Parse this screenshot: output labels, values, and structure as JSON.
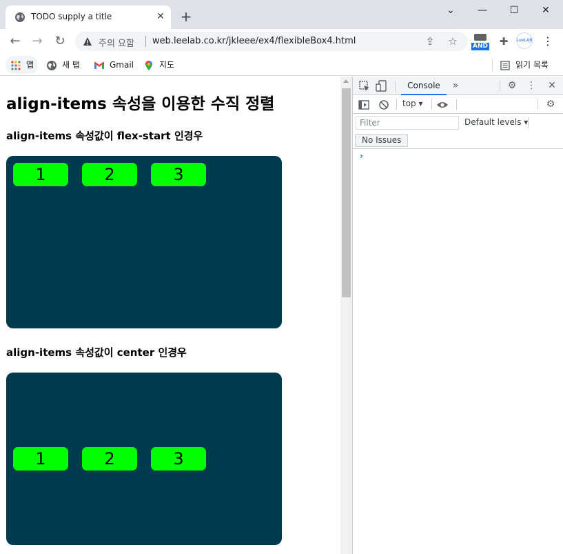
{
  "browser": {
    "tab_title": "TODO supply a title",
    "tab_close_glyph": "✕",
    "new_tab_glyph": "+",
    "window_controls": {
      "minimize": "—",
      "maximize": "☐",
      "close": "✕",
      "chevron": "⌄"
    },
    "nav": {
      "back": "←",
      "forward": "→",
      "reload": "↻"
    },
    "security_label": "주의 요함",
    "url": "web.leelab.co.kr/jkleee/ex4/flexibleBox4.html",
    "extensions": {
      "ext1_label": "AND",
      "ext2_label": "LeeLAB",
      "menu_glyph": "⋮"
    },
    "bookmarks": [
      {
        "label": "앱"
      },
      {
        "label": "새 탭"
      },
      {
        "label": "Gmail"
      },
      {
        "label": "지도"
      }
    ],
    "reading_list": "읽기 목록"
  },
  "page": {
    "heading": "align-items 속성을 이용한 수직 정렬",
    "sections": [
      {
        "subheading": "align-items 속성값이 flex-start 인경우",
        "items": [
          "1",
          "2",
          "3"
        ],
        "align": "flex-start"
      },
      {
        "subheading": "align-items 속성값이 center 인경우",
        "items": [
          "1",
          "2",
          "3"
        ],
        "align": "center"
      }
    ],
    "colors": {
      "container": "#003a4f",
      "item": "#00ff00"
    }
  },
  "devtools": {
    "active_tab": "Console",
    "more_tabs_glyph": "»",
    "context": "top",
    "filter_placeholder": "Filter",
    "levels": "Default levels",
    "issues": "No Issues",
    "prompt": "›"
  }
}
